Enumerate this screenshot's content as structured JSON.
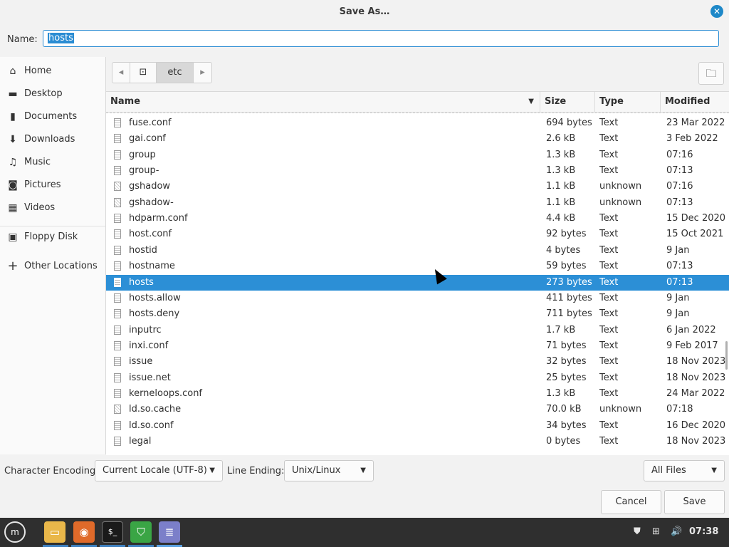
{
  "window": {
    "title": "Save As…"
  },
  "name_field": {
    "label": "Name:",
    "value": "hosts"
  },
  "sidebar": {
    "items": [
      {
        "label": "Home",
        "icon": "home-icon"
      },
      {
        "label": "Desktop",
        "icon": "desktop-icon"
      },
      {
        "label": "Documents",
        "icon": "documents-icon"
      },
      {
        "label": "Downloads",
        "icon": "downloads-icon"
      },
      {
        "label": "Music",
        "icon": "music-icon"
      },
      {
        "label": "Pictures",
        "icon": "pictures-icon"
      },
      {
        "label": "Videos",
        "icon": "videos-icon"
      },
      {
        "label": "Floppy Disk",
        "icon": "floppy-icon"
      },
      {
        "label": "Other Locations",
        "icon": "plus-icon"
      }
    ]
  },
  "pathbar": {
    "current": "etc"
  },
  "columns": {
    "name": "Name",
    "size": "Size",
    "type": "Type",
    "modified": "Modified"
  },
  "files": [
    {
      "name": "fuse.conf",
      "size": "694 bytes",
      "type": "Text",
      "modified": "23 Mar 2022"
    },
    {
      "name": "gai.conf",
      "size": "2.6 kB",
      "type": "Text",
      "modified": "3 Feb 2022"
    },
    {
      "name": "group",
      "size": "1.3 kB",
      "type": "Text",
      "modified": "07:16"
    },
    {
      "name": "group-",
      "size": "1.3 kB",
      "type": "Text",
      "modified": "07:13"
    },
    {
      "name": "gshadow",
      "size": "1.1 kB",
      "type": "unknown",
      "modified": "07:16"
    },
    {
      "name": "gshadow-",
      "size": "1.1 kB",
      "type": "unknown",
      "modified": "07:13"
    },
    {
      "name": "hdparm.conf",
      "size": "4.4 kB",
      "type": "Text",
      "modified": "15 Dec 2020"
    },
    {
      "name": "host.conf",
      "size": "92 bytes",
      "type": "Text",
      "modified": "15 Oct 2021"
    },
    {
      "name": "hostid",
      "size": "4 bytes",
      "type": "Text",
      "modified": "9 Jan"
    },
    {
      "name": "hostname",
      "size": "59 bytes",
      "type": "Text",
      "modified": "07:13"
    },
    {
      "name": "hosts",
      "size": "273 bytes",
      "type": "Text",
      "modified": "07:13",
      "selected": true
    },
    {
      "name": "hosts.allow",
      "size": "411 bytes",
      "type": "Text",
      "modified": "9 Jan"
    },
    {
      "name": "hosts.deny",
      "size": "711 bytes",
      "type": "Text",
      "modified": "9 Jan"
    },
    {
      "name": "inputrc",
      "size": "1.7 kB",
      "type": "Text",
      "modified": "6 Jan 2022"
    },
    {
      "name": "inxi.conf",
      "size": "71 bytes",
      "type": "Text",
      "modified": "9 Feb 2017"
    },
    {
      "name": "issue",
      "size": "32 bytes",
      "type": "Text",
      "modified": "18 Nov 2023"
    },
    {
      "name": "issue.net",
      "size": "25 bytes",
      "type": "Text",
      "modified": "18 Nov 2023"
    },
    {
      "name": "kerneloops.conf",
      "size": "1.3 kB",
      "type": "Text",
      "modified": "24 Mar 2022"
    },
    {
      "name": "ld.so.cache",
      "size": "70.0 kB",
      "type": "unknown",
      "modified": "07:18"
    },
    {
      "name": "ld.so.conf",
      "size": "34 bytes",
      "type": "Text",
      "modified": "16 Dec 2020"
    },
    {
      "name": "legal",
      "size": "0 bytes",
      "type": "Text",
      "modified": "18 Nov 2023"
    }
  ],
  "bottom": {
    "encoding_label": "Character Encoding:",
    "encoding_value": "Current Locale (UTF-8)",
    "line_ending_label": "Line Ending:",
    "line_ending_value": "Unix/Linux",
    "filter_value": "All Files"
  },
  "buttons": {
    "cancel": "Cancel",
    "save": "Save"
  },
  "taskbar": {
    "clock": "07:38"
  },
  "colors": {
    "accent": "#2c8fd6",
    "taskbar": "#2f2f2f"
  }
}
